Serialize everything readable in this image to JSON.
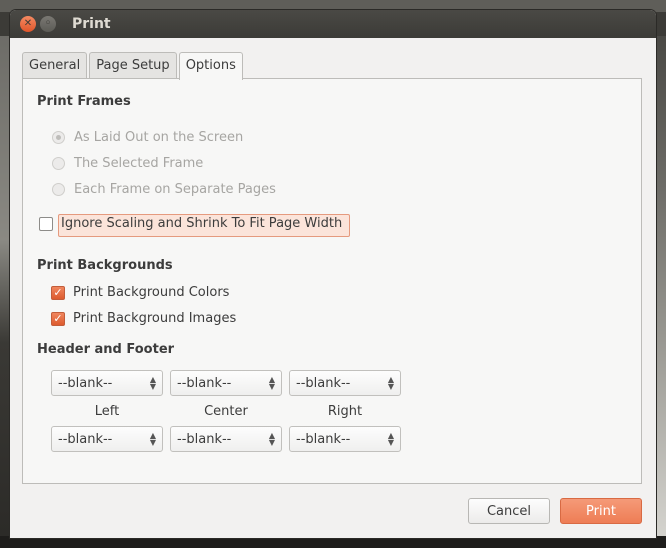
{
  "window": {
    "title": "Print"
  },
  "tabs": [
    "General",
    "Page Setup",
    "Options"
  ],
  "print_frames": {
    "title": "Print Frames",
    "options": [
      {
        "label": "As Laid Out on the Screen",
        "selected": true
      },
      {
        "label": "The Selected Frame",
        "selected": false
      },
      {
        "label": "Each Frame on Separate Pages",
        "selected": false
      }
    ]
  },
  "ignore_scaling": {
    "label": "Ignore Scaling and Shrink To Fit Page Width",
    "checked": false
  },
  "print_backgrounds": {
    "title": "Print Backgrounds",
    "colors": {
      "label": "Print Background Colors",
      "checked": true
    },
    "images": {
      "label": "Print Background Images",
      "checked": true
    }
  },
  "header_footer": {
    "title": "Header and Footer",
    "header": [
      "--blank--",
      "--blank--",
      "--blank--"
    ],
    "labels": [
      "Left",
      "Center",
      "Right"
    ],
    "footer": [
      "--blank--",
      "--blank--",
      "--blank--"
    ]
  },
  "buttons": {
    "cancel": "Cancel",
    "print": "Print"
  },
  "colors": {
    "accent": "#ee7d55",
    "titlebar": "#3c3b37"
  }
}
